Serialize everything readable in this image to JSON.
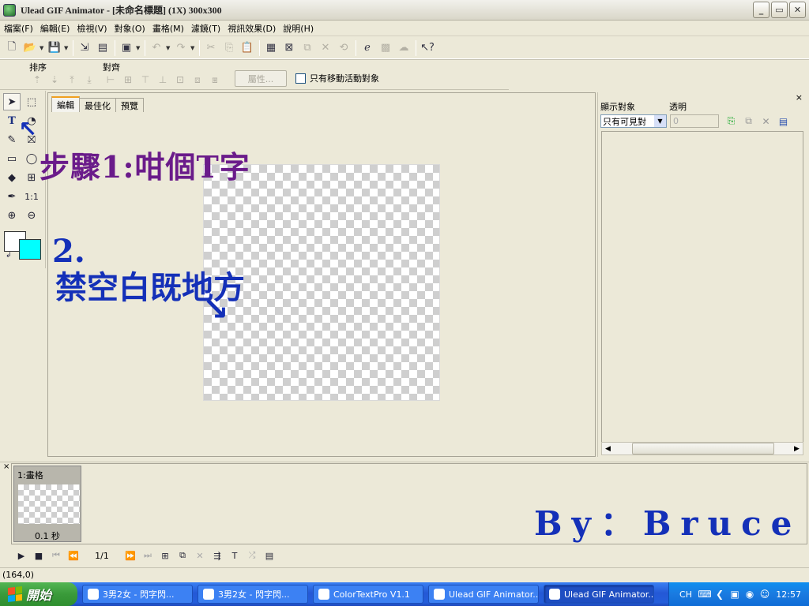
{
  "window": {
    "title": "Ulead GIF Animator - [未命名標題] (1X) 300x300",
    "buttons": [
      "_",
      "▭",
      "✕"
    ]
  },
  "menu": [
    "檔案(F)",
    "編輯(E)",
    "檢視(V)",
    "對象(O)",
    "畫格(M)",
    "濾鏡(T)",
    "視訊效果(D)",
    "說明(H)"
  ],
  "toolbar2": {
    "order_label": "排序",
    "align_label": "對齊",
    "properties_button": "屬性...",
    "checkbox_label": "只有移動活動對象"
  },
  "tools": {
    "text_tool": "T",
    "one_to_one": "1:1"
  },
  "colors": {
    "foreground": "#00ffff",
    "background": "#ffffff"
  },
  "editor": {
    "tabs": [
      "編輯",
      "最佳化",
      "預覽"
    ],
    "active_tab": "編輯"
  },
  "object_panel": {
    "col_display": "顯示對象",
    "col_opacity": "透明",
    "select_value": "只有可見對",
    "opacity_value": "0"
  },
  "frames": {
    "items": [
      {
        "label": "1:畫格",
        "delay": "0.1 秒"
      }
    ],
    "counter": "1/1"
  },
  "status": {
    "coords": "(164,0)"
  },
  "taskbar": {
    "start_label": "開始",
    "tasks": [
      {
        "label": "3男2女 - 閃字閃...",
        "active": false
      },
      {
        "label": "3男2女 - 閃字閃...",
        "active": false
      },
      {
        "label": "ColorTextPro V1.1",
        "active": false
      },
      {
        "label": "Ulead GIF Animator...",
        "active": false
      },
      {
        "label": "Ulead GIF Animator...",
        "active": true
      }
    ],
    "tray_lang": "CH",
    "clock": "12:57"
  },
  "annotations": {
    "step1": "步驟1:咁個T字",
    "step2_number": "2.",
    "step2": "禁空白既地方",
    "arrow": "↘",
    "byline": "By：Bruce"
  }
}
